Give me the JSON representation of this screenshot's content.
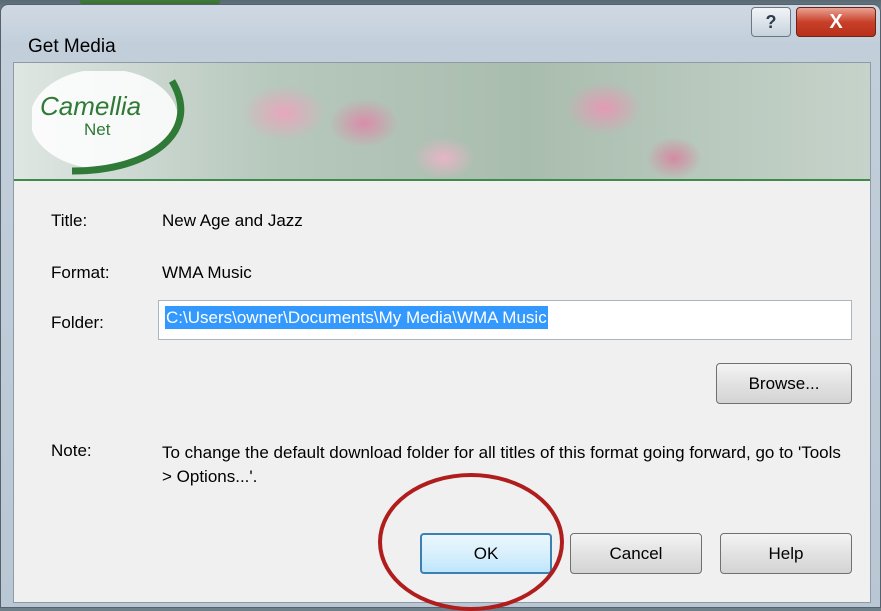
{
  "window": {
    "title": "Get Media",
    "help_glyph": "?",
    "close_glyph": "X"
  },
  "banner": {
    "logo_text_top": "Camellia",
    "logo_text_bottom": "Net"
  },
  "fields": {
    "title_label": "Title:",
    "title_value": "New Age and Jazz",
    "format_label": "Format:",
    "format_value": "WMA Music",
    "folder_label": "Folder:",
    "folder_value": "C:\\Users\\owner\\Documents\\My Media\\WMA Music"
  },
  "buttons": {
    "browse": "Browse...",
    "ok": "OK",
    "cancel": "Cancel",
    "help": "Help"
  },
  "note": {
    "label": "Note:",
    "text": "To change the default download folder for all titles of this format going forward, go to 'Tools > Options...'."
  },
  "colors": {
    "selection": "#3399ff",
    "annotation_circle": "#b01d1d",
    "logo_green": "#2f7a36"
  }
}
